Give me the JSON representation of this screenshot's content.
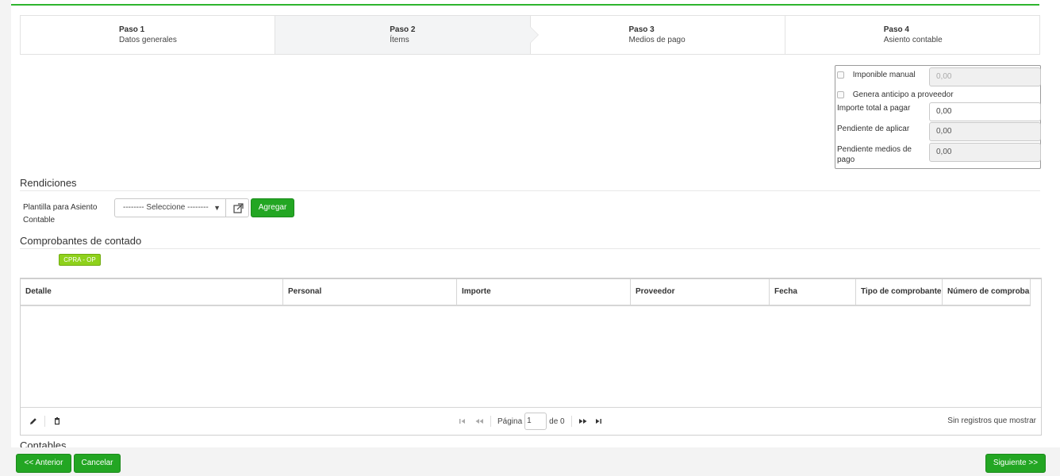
{
  "wizard": {
    "steps": [
      {
        "num": "Paso 1",
        "label": "Datos generales"
      },
      {
        "num": "Paso 2",
        "label": "Ítems"
      },
      {
        "num": "Paso 3",
        "label": "Medios de pago"
      },
      {
        "num": "Paso 4",
        "label": "Asiento contable"
      }
    ]
  },
  "summary": {
    "imponible_manual_label": "Imponible manual",
    "imponible_manual_value": "0,00",
    "genera_anticipo_label": "Genera anticipo a proveedor",
    "importe_total_label": "Importe total a pagar",
    "importe_total_value": "0,00",
    "pendiente_aplicar_label": "Pendiente de aplicar",
    "pendiente_aplicar_value": "0,00",
    "pendiente_medios_label": "Pendiente medios de pago",
    "pendiente_medios_value": "0,00"
  },
  "rendiciones": {
    "title": "Rendiciones",
    "plantilla_label": "Plantilla para Asiento Contable",
    "select_value": "-------- Seleccione --------",
    "agregar_label": "Agregar"
  },
  "comprobantes": {
    "title": "Comprobantes de contado",
    "badge": "CPRA - OP",
    "columns": [
      "Detalle",
      "Personal",
      "Importe",
      "Proveedor",
      "Fecha",
      "Tipo de comprobante",
      "Número de comprobante"
    ],
    "pager": {
      "page_label": "Página",
      "page_value": "1",
      "of_label": "de 0"
    },
    "empty_message": "Sin registros que mostrar"
  },
  "next_section_title": "Contables",
  "footer": {
    "anterior_label": "<< Anterior",
    "cancelar_label": "Cancelar",
    "siguiente_label": "Siguiente >>"
  },
  "colors": {
    "accent": "#23a623",
    "badge": "#8ed11b",
    "topline": "#2fb52f"
  }
}
